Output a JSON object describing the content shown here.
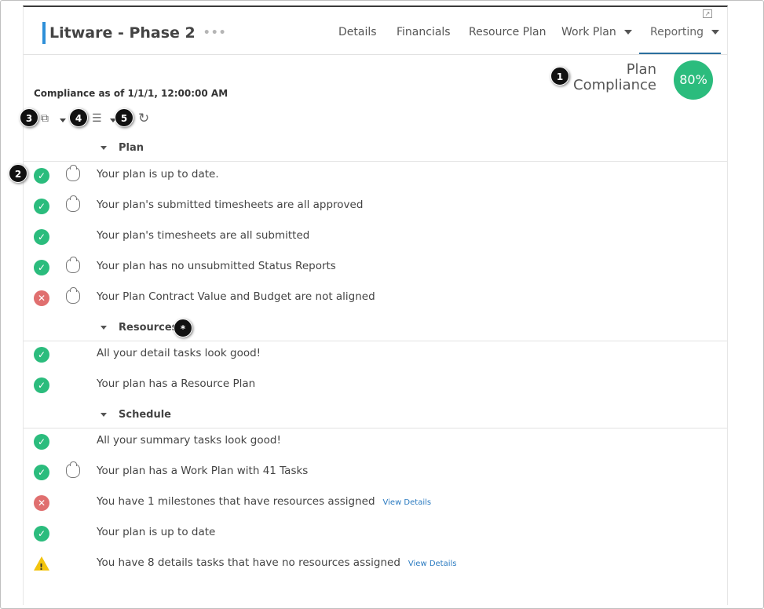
{
  "header": {
    "title": "Litware - Phase 2",
    "title_menu": "•••",
    "popout_icon": "popout-icon",
    "tabs": [
      {
        "label": "Details"
      },
      {
        "label": "Financials"
      },
      {
        "label": "Resource Plan"
      },
      {
        "label": "Work Plan",
        "dropdown": true
      },
      {
        "label": "Reporting",
        "dropdown": true,
        "active": true
      }
    ]
  },
  "compliance": {
    "label": "Plan\nCompliance",
    "percent_text": "80%",
    "percent": 80,
    "as_of": "Compliance as of 1/1/1, 12:00:00 AM",
    "accent": "#2bbc7d"
  },
  "toolbar": {
    "icons": [
      "copy-icon",
      "list-filter-icon",
      "refresh-icon"
    ]
  },
  "sections": [
    {
      "label": "Plan",
      "rows": [
        {
          "status": "ok",
          "shield": true,
          "text": "Your plan is up to date."
        },
        {
          "status": "ok",
          "shield": true,
          "text": "Your plan's submitted timesheets are all approved"
        },
        {
          "status": "ok",
          "shield": false,
          "text": "Your plan's timesheets are all submitted"
        },
        {
          "status": "ok",
          "shield": true,
          "text": "Your plan has no unsubmitted Status Reports"
        },
        {
          "status": "err",
          "shield": true,
          "text": "Your Plan Contract Value and Budget are not aligned"
        }
      ]
    },
    {
      "label": "Resources",
      "rows": [
        {
          "status": "ok",
          "shield": false,
          "text": "All your detail tasks look good!"
        },
        {
          "status": "ok",
          "shield": false,
          "text": "Your plan has a Resource Plan"
        }
      ]
    },
    {
      "label": "Schedule",
      "rows": [
        {
          "status": "ok",
          "shield": false,
          "text": "All your summary tasks look good!"
        },
        {
          "status": "ok",
          "shield": true,
          "text": "Your plan has a Work Plan with 41 Tasks"
        },
        {
          "status": "err",
          "shield": false,
          "text": "You have 1 milestones that have resources assigned",
          "link": "View Details"
        },
        {
          "status": "ok",
          "shield": false,
          "text": "Your plan is up to date"
        },
        {
          "status": "warn",
          "shield": false,
          "text": "You have 8 details tasks that have no resources assigned",
          "link": "View Details"
        }
      ]
    }
  ],
  "callouts": [
    "1",
    "2",
    "3",
    "4",
    "5",
    "*"
  ],
  "colors": {
    "ok": "#2bbc7d",
    "error": "#e06f6f",
    "warning": "#f2c40f",
    "title_accent": "#2e8fd8"
  }
}
